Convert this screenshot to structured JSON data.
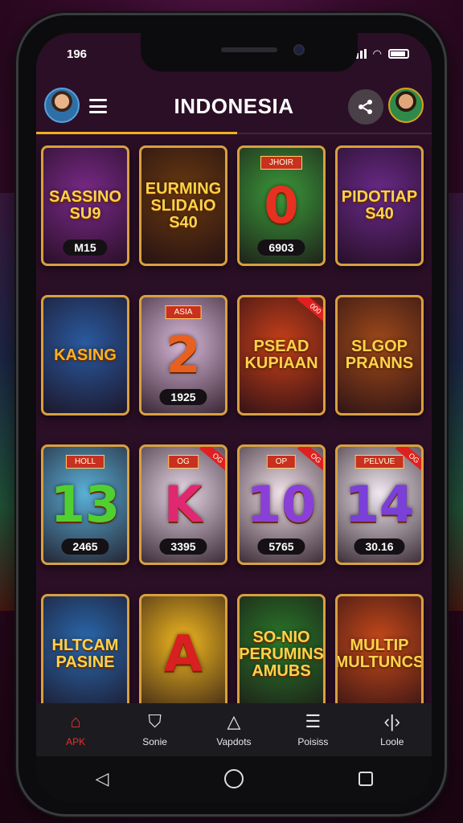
{
  "status": {
    "time": "196"
  },
  "header": {
    "title": "INDONESIA"
  },
  "icons": {
    "menu": "menu-icon",
    "share": "share-icon",
    "profile": "avatar"
  },
  "games": [
    {
      "title": "SASSINO SU9",
      "tag": "M15",
      "theme": "#7a2a8a",
      "accent": "#ffd24a"
    },
    {
      "title": "EURMING SLIDAIO S40",
      "tag": "",
      "theme": "#6a3a10",
      "accent": "#ffd24a"
    },
    {
      "title": "0",
      "plaque": "JHOIR",
      "tag": "6903",
      "theme": "#3a9a3a",
      "accent": "#e83020"
    },
    {
      "title": "PIDOTIAP S40",
      "tag": "",
      "theme": "#6a2a8a",
      "accent": "#ffd24a"
    },
    {
      "title": "KASING",
      "tag": "",
      "theme": "#2a5aa0",
      "accent": "#ffb020"
    },
    {
      "title": "2",
      "plaque": "ASIA",
      "tag": "1925",
      "theme": "#d8b8d8",
      "accent": "#e86020"
    },
    {
      "title": "PSEAD KUPIAAN",
      "ribbon": "000",
      "tag": "",
      "theme": "#c8401a",
      "accent": "#ffd24a"
    },
    {
      "title": "SLGOP PRANNS",
      "tag": "",
      "theme": "#a04a1a",
      "accent": "#ffd24a"
    },
    {
      "title": "13",
      "plaque": "HOLL",
      "tag": "2465",
      "theme": "#5ab0d8",
      "accent": "#50d030"
    },
    {
      "title": "K",
      "plaque": "OG",
      "ribbon": "OG",
      "tag": "3395",
      "theme": "#e8d8e8",
      "accent": "#e02870"
    },
    {
      "title": "10",
      "plaque": "OP",
      "ribbon": "OG",
      "tag": "5765",
      "theme": "#f0e0e8",
      "accent": "#8a40d8"
    },
    {
      "title": "14",
      "plaque": "PELVUE",
      "ribbon": "OG",
      "tag": "30.16",
      "theme": "#f0e8f0",
      "accent": "#7a40d8"
    },
    {
      "title": "HLTCAM PASINE",
      "tag": "",
      "theme": "#2a6ab0",
      "accent": "#ffd24a"
    },
    {
      "title": "A",
      "tag": "",
      "theme": "#f0b820",
      "accent": "#d82020"
    },
    {
      "title": "SO-NIO PERUMINS AMUBS",
      "tag": "",
      "theme": "#2a7a2a",
      "accent": "#ffd24a"
    },
    {
      "title": "MULTIP MULTUNCS",
      "tag": "",
      "theme": "#c84a1a",
      "accent": "#ffd24a"
    }
  ],
  "tabs": [
    {
      "label": "APK",
      "icon": "home-icon",
      "glyph": "⌂",
      "active": true
    },
    {
      "label": "Sonie",
      "icon": "bag-icon",
      "glyph": "⛉",
      "active": false
    },
    {
      "label": "Vapdots",
      "icon": "triangle-icon",
      "glyph": "△",
      "active": false
    },
    {
      "label": "Poisiss",
      "icon": "list-icon",
      "glyph": "☰",
      "active": false
    },
    {
      "label": "Loole",
      "icon": "code-icon",
      "glyph": "‹|›",
      "active": false
    }
  ]
}
